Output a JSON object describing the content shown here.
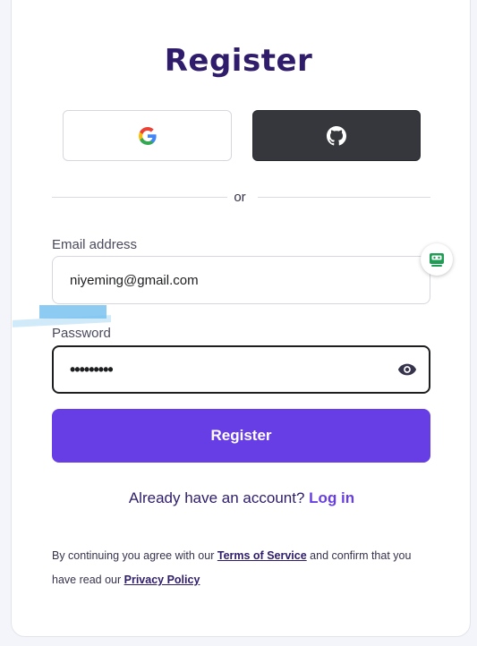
{
  "title": "Register",
  "social": {
    "google_icon": "google-g-icon",
    "github_icon": "github-icon"
  },
  "divider_text": "or",
  "email": {
    "label": "Email address",
    "value": "niyeming@gmail.com"
  },
  "password": {
    "label": "Password",
    "value": "•••••••••",
    "toggle_icon": "eye-icon"
  },
  "register_button": "Register",
  "login_prompt": {
    "text": "Already have an account?",
    "link": "Log in"
  },
  "terms": {
    "prefix": "By continuing you agree with our",
    "tos_link": "Terms of Service",
    "middle": "and confirm that you have read our",
    "privacy_link": "Privacy Policy"
  },
  "colors": {
    "brand": "#673de6",
    "heading": "#2f1c6a",
    "github_bg": "#36373d"
  }
}
